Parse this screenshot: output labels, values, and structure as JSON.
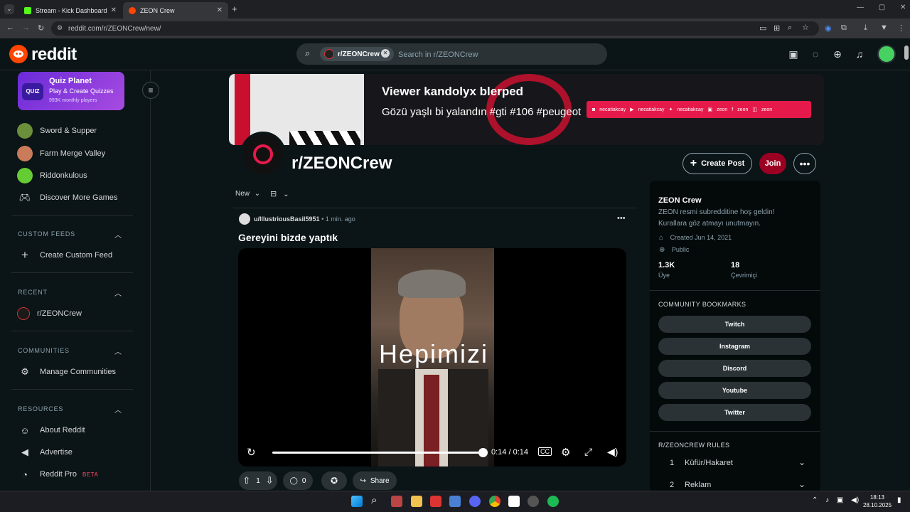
{
  "browser": {
    "tabs": [
      {
        "label": "Stream - Kick Dashboard",
        "active": false
      },
      {
        "label": "ZEON Crew",
        "active": true
      }
    ],
    "new_tab": "+",
    "url": "reddit.com/r/ZEONCrew/new/"
  },
  "header": {
    "logo": "reddit",
    "search_chip": "r/ZEONCrew",
    "search_placeholder": "Search in r/ZEONCrew"
  },
  "sidebar": {
    "promo": {
      "title": "Quiz Planet",
      "subtitle": "Play & Create Quizzes",
      "meta": "993K monthly players",
      "badge": "QUIZ"
    },
    "games": [
      {
        "label": "Sword & Supper",
        "icon": "sword-supper-icon"
      },
      {
        "label": "Farm Merge Valley",
        "icon": "farm-merge-icon"
      },
      {
        "label": "Riddonkulous",
        "icon": "riddonkulous-icon"
      },
      {
        "label": "Discover More Games",
        "icon": "gamepad-icon"
      }
    ],
    "custom_feeds": {
      "heading": "CUSTOM FEEDS",
      "item": "Create Custom Feed"
    },
    "recent": {
      "heading": "RECENT",
      "item": "r/ZEONCrew"
    },
    "communities": {
      "heading": "COMMUNITIES",
      "item": "Manage Communities"
    },
    "resources": {
      "heading": "RESOURCES",
      "items": [
        "About Reddit",
        "Advertise",
        "Reddit Pro"
      ],
      "beta": "BETA"
    }
  },
  "banner": {
    "line1": "Viewer kandolyx blerped",
    "line2": "Gözü yaşlı bi yalandın #gti #106 #peugeot",
    "socials": [
      "necatiakcay",
      "necatiakcay",
      "necatiakcay",
      "zeon",
      "zeon",
      "zeon"
    ]
  },
  "community": {
    "name": "r/ZEONCrew",
    "create_post": "Create Post",
    "join": "Join"
  },
  "feed": {
    "sort": "New",
    "post": {
      "author": "u/IllustriousBasil5951",
      "time": "1 min. ago",
      "title": "Gereyini bizde yaptık",
      "video_caption": "Hepimizi",
      "time_display": "0:14 / 0:14",
      "progress": 1.0,
      "votes": "1",
      "comments": "0",
      "share": "Share"
    }
  },
  "about": {
    "title": "ZEON Crew",
    "description": "ZEON resmi subredditine hoş geldin! Kurallara göz atmayı unutmayın.",
    "created": "Created Jun 14, 2021",
    "visibility": "Public",
    "members_value": "1.3K",
    "members_label": "Üye",
    "online_value": "18",
    "online_label": "Çevrimiçi",
    "bookmarks_heading": "COMMUNITY BOOKMARKS",
    "bookmarks": [
      "Twitch",
      "Instagram",
      "Discord",
      "Youtube",
      "Twitter"
    ],
    "rules_heading": "R/ZEONCREW RULES",
    "rules": [
      {
        "num": "1",
        "label": "Küfür/Hakaret"
      },
      {
        "num": "2",
        "label": "Reklam"
      }
    ]
  },
  "taskbar": {
    "time": "18:13",
    "date": "28.10.2025"
  }
}
